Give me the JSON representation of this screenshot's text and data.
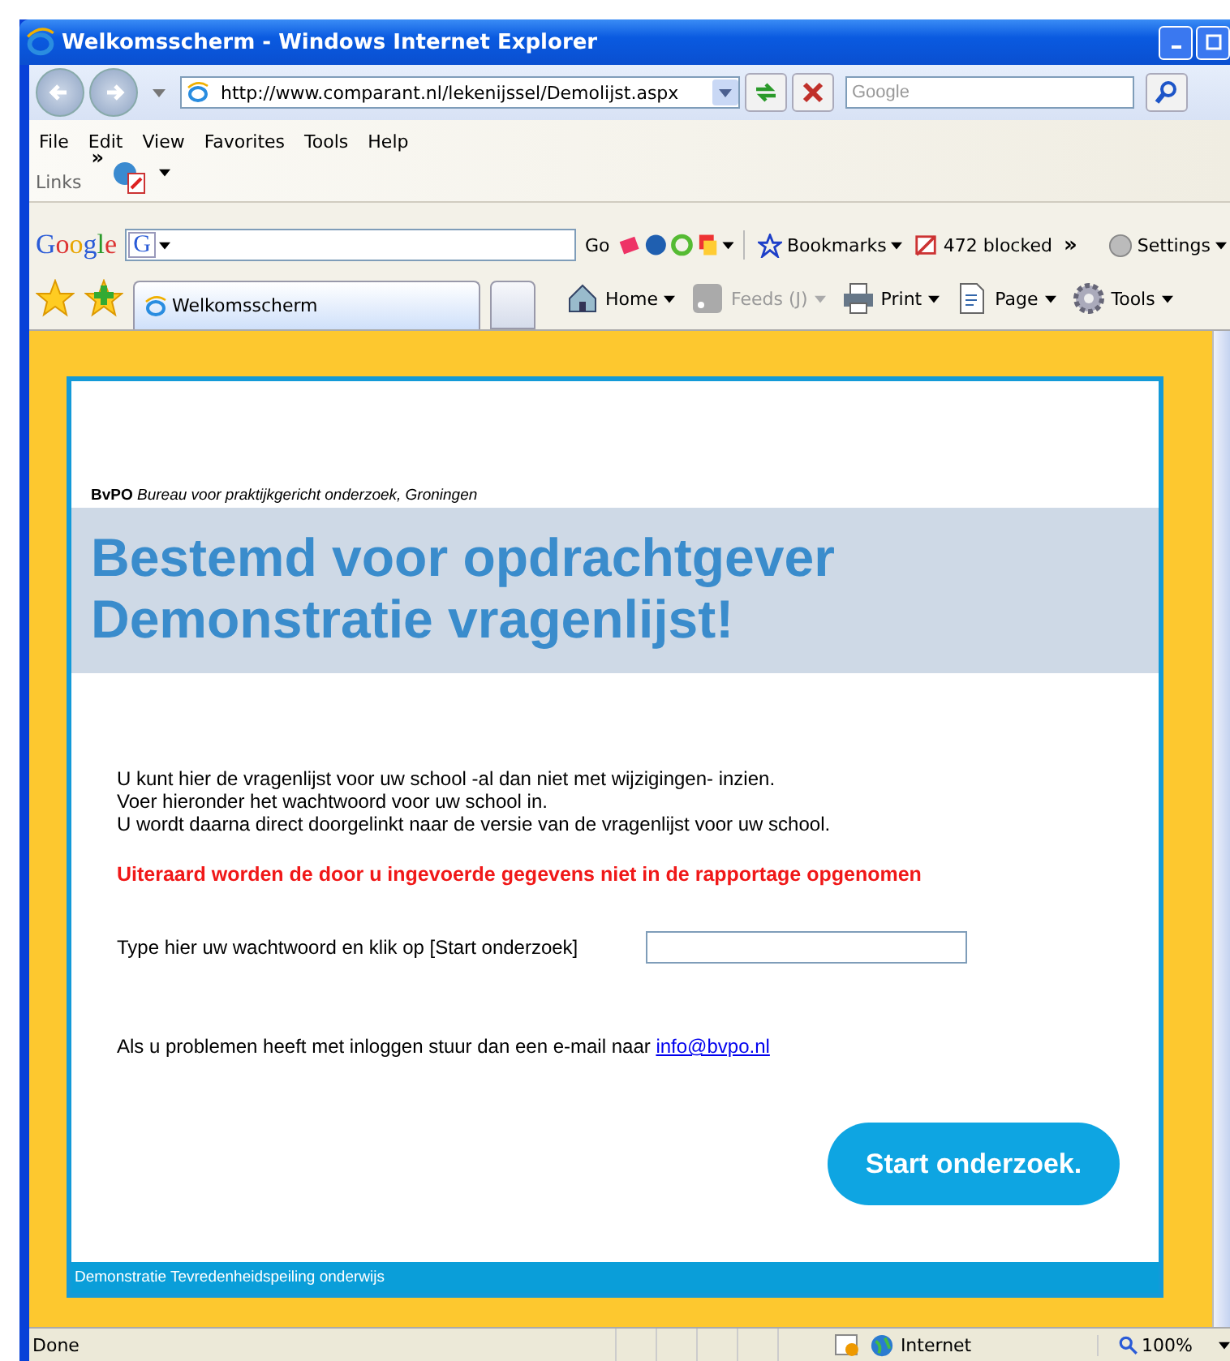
{
  "window": {
    "title": "Welkomsscherm - Windows Internet Explorer"
  },
  "address": {
    "url": "http://www.comparant.nl/lekenijssel/Demolijst.aspx"
  },
  "search": {
    "placeholder": "Google"
  },
  "menu": [
    "File",
    "Edit",
    "View",
    "Favorites",
    "Tools",
    "Help"
  ],
  "links": {
    "label": "Links",
    "chevron": "»"
  },
  "google_toolbar": {
    "logo": "Google",
    "engine_letter": "G",
    "go": "Go",
    "bookmarks": "Bookmarks",
    "blocked": "472 blocked",
    "chevron": "»",
    "settings": "Settings"
  },
  "tab": {
    "title": "Welkomsscherm"
  },
  "commands": [
    {
      "label": "Home",
      "disabled": false
    },
    {
      "label": "Feeds (J)",
      "disabled": true
    },
    {
      "label": "Print",
      "disabled": false
    },
    {
      "label": "Page",
      "disabled": false
    },
    {
      "label": "Tools",
      "disabled": false
    }
  ],
  "page": {
    "org": "BvPO",
    "org_desc": "Bureau voor praktijkgericht onderzoek, Groningen",
    "heading": [
      "Bestemd voor opdrachtgever",
      "Demonstratie vragenlijst!"
    ],
    "intro": [
      "U kunt hier de vragenlijst voor uw school -al dan niet met wijzigingen- inzien.",
      "Voer hieronder het wachtwoord voor uw school in.",
      "U wordt daarna direct doorgelinkt naar de versie van de vragenlijst voor uw school."
    ],
    "warning": "Uiteraard worden de door u ingevoerde gegevens niet in de rapportage opgenomen",
    "prompt": "Type hier uw wachtwoord en klik op [Start onderzoek]",
    "contact": "Als u problemen heeft met inloggen stuur dan een e-mail naar",
    "email": "info@bvpo.nl",
    "button": "Start onderzoek.",
    "footer": "Demonstratie Tevredenheidspeiling onderwijs"
  },
  "status": {
    "text": "Done",
    "zone": "Internet",
    "zoom": "100%"
  }
}
